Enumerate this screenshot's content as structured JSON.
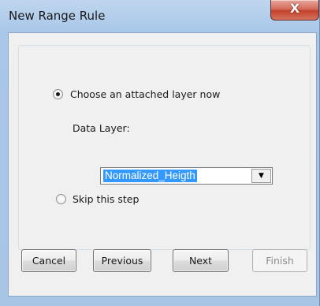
{
  "window": {
    "title": "New Range Rule",
    "close_symbol": "X"
  },
  "options": {
    "attached_layer": {
      "label": "Choose an attached layer now",
      "selected": true
    },
    "data_layer": {
      "label": "Data Layer:",
      "value": "Normalized_Heigth",
      "dropdown_symbol": "▼"
    },
    "skip": {
      "label": "Skip this step",
      "selected": false
    }
  },
  "buttons": {
    "cancel": "Cancel",
    "previous": "Previous",
    "next": "Next",
    "finish": "Finish",
    "finish_enabled": false
  },
  "colors": {
    "selection_highlight": "#3399ff",
    "close_button": "#c3412c",
    "window_frame": "#a9c7e9"
  }
}
